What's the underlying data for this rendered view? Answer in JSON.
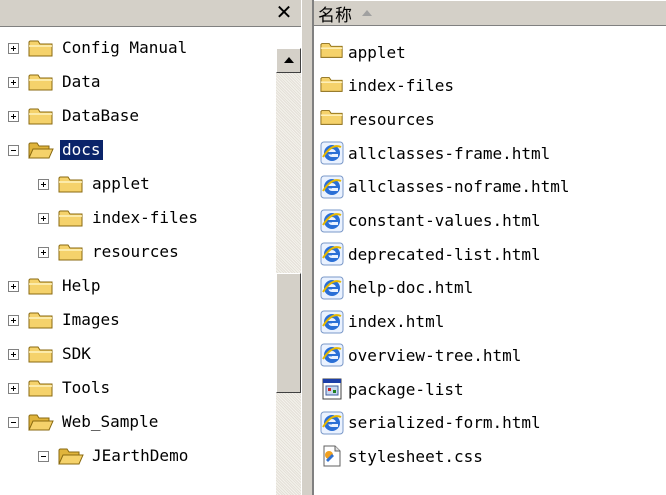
{
  "left_pane": {
    "close_glyph": "✕",
    "tree": [
      {
        "label": "Config Manual",
        "expander": "plus",
        "level": 0,
        "selected": false
      },
      {
        "label": "Data",
        "expander": "plus",
        "level": 0,
        "selected": false
      },
      {
        "label": "DataBase",
        "expander": "plus",
        "level": 0,
        "selected": false
      },
      {
        "label": "docs",
        "expander": "minus",
        "level": 0,
        "selected": true,
        "open": true
      },
      {
        "label": "applet",
        "expander": "plus",
        "level": 1,
        "selected": false
      },
      {
        "label": "index-files",
        "expander": "plus",
        "level": 1,
        "selected": false
      },
      {
        "label": "resources",
        "expander": "plus",
        "level": 1,
        "selected": false
      },
      {
        "label": "Help",
        "expander": "plus",
        "level": 0,
        "selected": false
      },
      {
        "label": "Images",
        "expander": "plus",
        "level": 0,
        "selected": false
      },
      {
        "label": "SDK",
        "expander": "plus",
        "level": 0,
        "selected": false
      },
      {
        "label": "Tools",
        "expander": "plus",
        "level": 0,
        "selected": false
      },
      {
        "label": "Web_Sample",
        "expander": "minus",
        "level": 0,
        "selected": false,
        "open": true
      },
      {
        "label": "JEarthDemo",
        "expander": "minus",
        "level": 1,
        "selected": false,
        "open": true
      }
    ]
  },
  "right_pane": {
    "column_header": "名称",
    "sort_direction": "ascending",
    "files": [
      {
        "label": "applet",
        "icon": "folder-icon"
      },
      {
        "label": "index-files",
        "icon": "folder-icon"
      },
      {
        "label": "resources",
        "icon": "folder-icon"
      },
      {
        "label": "allclasses-frame.html",
        "icon": "ie-html-icon"
      },
      {
        "label": "allclasses-noframe.html",
        "icon": "ie-html-icon"
      },
      {
        "label": "constant-values.html",
        "icon": "ie-html-icon"
      },
      {
        "label": "deprecated-list.html",
        "icon": "ie-html-icon"
      },
      {
        "label": "help-doc.html",
        "icon": "ie-html-icon"
      },
      {
        "label": "index.html",
        "icon": "ie-html-icon"
      },
      {
        "label": "overview-tree.html",
        "icon": "ie-html-icon"
      },
      {
        "label": "package-list",
        "icon": "generic-file-icon"
      },
      {
        "label": "serialized-form.html",
        "icon": "ie-html-icon"
      },
      {
        "label": "stylesheet.css",
        "icon": "css-file-icon"
      }
    ]
  },
  "colors": {
    "chrome": "#d4d0c8",
    "selection": "#0a246a",
    "folder": "#f5d26b",
    "ie_blue": "#2a6fd6"
  }
}
